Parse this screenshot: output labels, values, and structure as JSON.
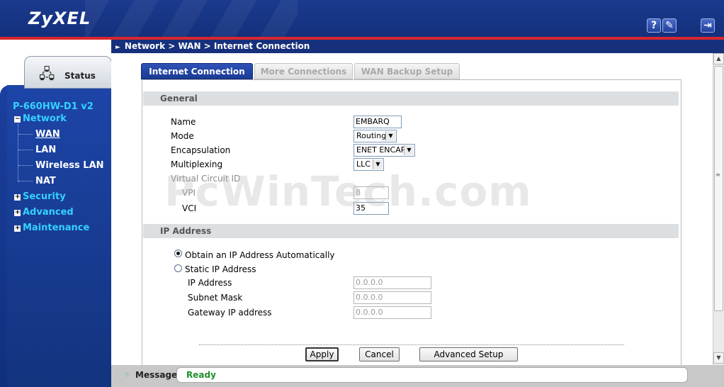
{
  "header": {
    "logo": "ZyXEL",
    "help_icon": "?",
    "wizard_icon": "✎",
    "logout_icon": "⇥"
  },
  "breadcrumb": "Network > WAN > Internet Connection",
  "sidebar": {
    "status_tab": "Status",
    "model": "P-660HW-D1 v2",
    "network": "Network",
    "network_items": [
      "WAN",
      "LAN",
      "Wireless LAN",
      "NAT"
    ],
    "security": "Security",
    "advanced": "Advanced",
    "maintenance": "Maintenance"
  },
  "tabs": [
    "Internet Connection",
    "More Connections",
    "WAN Backup Setup"
  ],
  "general": {
    "title": "General",
    "name_label": "Name",
    "name_value": "EMBARQ",
    "mode_label": "Mode",
    "mode_value": "Routing",
    "encap_label": "Encapsulation",
    "encap_value": "ENET ENCAP",
    "mux_label": "Multiplexing",
    "mux_value": "LLC",
    "vc_label": "Virtual Circuit ID",
    "vpi_label": "VPI",
    "vpi_value": "8",
    "vci_label": "VCI",
    "vci_value": "35"
  },
  "ip": {
    "title": "IP Address",
    "auto_label": "Obtain an IP Address Automatically",
    "static_label": "Static IP Address",
    "ip_label": "IP Address",
    "ip_value": "0.0.0.0",
    "mask_label": "Subnet Mask",
    "mask_value": "0.0.0.0",
    "gw_label": "Gateway IP address",
    "gw_value": "0.0.0.0",
    "selected": "auto"
  },
  "buttons": {
    "apply": "Apply",
    "cancel": "Cancel",
    "advanced": "Advanced Setup"
  },
  "status": {
    "label": "Message",
    "value": "Ready"
  },
  "watermark": "PcWinTech.com"
}
